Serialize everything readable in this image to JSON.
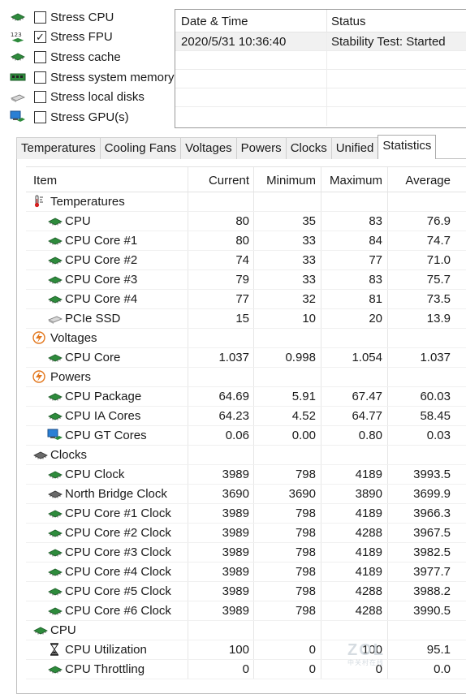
{
  "stress_options": [
    {
      "label": "Stress CPU",
      "checked": false,
      "icon": "cpu-chip-icon"
    },
    {
      "label": "Stress FPU",
      "checked": true,
      "icon": "fpu-123-icon"
    },
    {
      "label": "Stress cache",
      "checked": false,
      "icon": "cache-chip-icon"
    },
    {
      "label": "Stress system memory",
      "checked": false,
      "icon": "memory-module-icon"
    },
    {
      "label": "Stress local disks",
      "checked": false,
      "icon": "disk-drive-icon"
    },
    {
      "label": "Stress GPU(s)",
      "checked": false,
      "icon": "gpu-monitor-icon"
    }
  ],
  "fpu_icon_text": "123",
  "status_log": {
    "headers": [
      "Date & Time",
      "Status"
    ],
    "rows": [
      {
        "datetime": "2020/5/31 10:36:40",
        "status": "Stability Test: Started"
      }
    ]
  },
  "tabs": [
    {
      "label": "Temperatures",
      "active": false
    },
    {
      "label": "Cooling Fans",
      "active": false
    },
    {
      "label": "Voltages",
      "active": false
    },
    {
      "label": "Powers",
      "active": false
    },
    {
      "label": "Clocks",
      "active": false
    },
    {
      "label": "Unified",
      "active": false
    },
    {
      "label": "Statistics",
      "active": true
    }
  ],
  "stats": {
    "headers": {
      "item": "Item",
      "current": "Current",
      "minimum": "Minimum",
      "maximum": "Maximum",
      "average": "Average"
    },
    "rows": [
      {
        "type": "cat",
        "icon": "thermometer-icon",
        "name": "Temperatures"
      },
      {
        "type": "item",
        "icon": "cpu-chip-icon",
        "name": "CPU",
        "cur": "80",
        "min": "35",
        "max": "83",
        "avg": "76.9"
      },
      {
        "type": "item",
        "icon": "cpu-chip-icon",
        "name": "CPU Core #1",
        "cur": "80",
        "min": "33",
        "max": "84",
        "avg": "74.7"
      },
      {
        "type": "item",
        "icon": "cpu-chip-icon",
        "name": "CPU Core #2",
        "cur": "74",
        "min": "33",
        "max": "77",
        "avg": "71.0"
      },
      {
        "type": "item",
        "icon": "cpu-chip-icon",
        "name": "CPU Core #3",
        "cur": "79",
        "min": "33",
        "max": "83",
        "avg": "75.7"
      },
      {
        "type": "item",
        "icon": "cpu-chip-icon",
        "name": "CPU Core #4",
        "cur": "77",
        "min": "32",
        "max": "81",
        "avg": "73.5"
      },
      {
        "type": "item",
        "icon": "ssd-drive-icon",
        "name": "PCIe SSD",
        "cur": "15",
        "min": "10",
        "max": "20",
        "avg": "13.9"
      },
      {
        "type": "cat",
        "icon": "lightning-icon",
        "name": "Voltages"
      },
      {
        "type": "item",
        "icon": "cpu-chip-icon",
        "name": "CPU Core",
        "cur": "1.037",
        "min": "0.998",
        "max": "1.054",
        "avg": "1.037"
      },
      {
        "type": "cat",
        "icon": "lightning-icon",
        "name": "Powers"
      },
      {
        "type": "item",
        "icon": "cpu-chip-icon",
        "name": "CPU Package",
        "cur": "64.69",
        "min": "5.91",
        "max": "67.47",
        "avg": "60.03"
      },
      {
        "type": "item",
        "icon": "cpu-chip-icon",
        "name": "CPU IA Cores",
        "cur": "64.23",
        "min": "4.52",
        "max": "64.77",
        "avg": "58.45"
      },
      {
        "type": "item",
        "icon": "gpu-monitor-icon",
        "name": "CPU GT Cores",
        "cur": "0.06",
        "min": "0.00",
        "max": "0.80",
        "avg": "0.03"
      },
      {
        "type": "cat",
        "icon": "clock-chip-icon",
        "name": "Clocks"
      },
      {
        "type": "item",
        "icon": "cpu-chip-icon",
        "name": "CPU Clock",
        "cur": "3989",
        "min": "798",
        "max": "4189",
        "avg": "3993.5"
      },
      {
        "type": "item",
        "icon": "northbridge-chip-icon",
        "name": "North Bridge Clock",
        "cur": "3690",
        "min": "3690",
        "max": "3890",
        "avg": "3699.9"
      },
      {
        "type": "item",
        "icon": "cpu-chip-icon",
        "name": "CPU Core #1 Clock",
        "cur": "3989",
        "min": "798",
        "max": "4189",
        "avg": "3966.3"
      },
      {
        "type": "item",
        "icon": "cpu-chip-icon",
        "name": "CPU Core #2 Clock",
        "cur": "3989",
        "min": "798",
        "max": "4288",
        "avg": "3967.5"
      },
      {
        "type": "item",
        "icon": "cpu-chip-icon",
        "name": "CPU Core #3 Clock",
        "cur": "3989",
        "min": "798",
        "max": "4189",
        "avg": "3982.5"
      },
      {
        "type": "item",
        "icon": "cpu-chip-icon",
        "name": "CPU Core #4 Clock",
        "cur": "3989",
        "min": "798",
        "max": "4189",
        "avg": "3977.7"
      },
      {
        "type": "item",
        "icon": "cpu-chip-icon",
        "name": "CPU Core #5 Clock",
        "cur": "3989",
        "min": "798",
        "max": "4288",
        "avg": "3988.2"
      },
      {
        "type": "item",
        "icon": "cpu-chip-icon",
        "name": "CPU Core #6 Clock",
        "cur": "3989",
        "min": "798",
        "max": "4288",
        "avg": "3990.5"
      },
      {
        "type": "cat",
        "icon": "cpu-chip-icon",
        "name": "CPU"
      },
      {
        "type": "item",
        "icon": "hourglass-icon",
        "name": "CPU Utilization",
        "cur": "100",
        "min": "0",
        "max": "100",
        "avg": "95.1"
      },
      {
        "type": "item",
        "icon": "cpu-chip-icon",
        "name": "CPU Throttling",
        "cur": "0",
        "min": "0",
        "max": "0",
        "avg": "0.0"
      }
    ]
  },
  "watermark": {
    "text": "ZOL",
    "subtext": "中关村在线"
  },
  "colors": {
    "chip_green": "#2e8b3c",
    "chip_gray": "#6a6a6a",
    "thermo_red": "#d62020",
    "bolt_orange": "#e2761b",
    "monitor_blue": "#2a7fd4"
  }
}
